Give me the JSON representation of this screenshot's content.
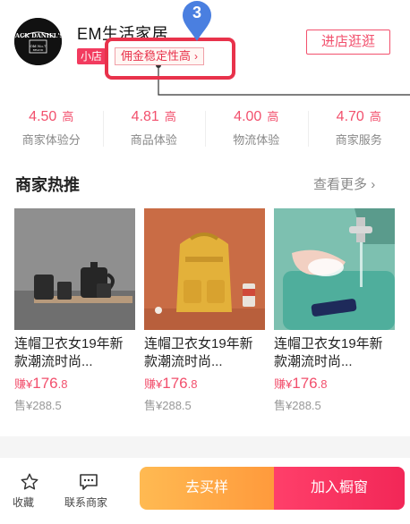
{
  "shop": {
    "name": "EM生活家居",
    "tag": "小店",
    "commission_label": "佣金稳定性高",
    "enter_label": "进店逛逛",
    "logo_text": "JACK DANIEL'S"
  },
  "annotation": {
    "step_number": "3"
  },
  "ratings": [
    {
      "value": "4.50",
      "level": "高",
      "label": "商家体验分"
    },
    {
      "value": "4.81",
      "level": "高",
      "label": "商品体验"
    },
    {
      "value": "4.00",
      "level": "高",
      "label": "物流体验"
    },
    {
      "value": "4.70",
      "level": "高",
      "label": "商家服务"
    }
  ],
  "recommend": {
    "title": "商家热推",
    "more_label": "查看更多",
    "products": [
      {
        "title": "连帽卫衣女19年新款潮流时尚...",
        "earn_prefix": "赚¥",
        "earn_int": "176",
        "earn_dec": ".8",
        "sale": "售¥288.5",
        "image": "coffee-set"
      },
      {
        "title": "连帽卫衣女19年新款潮流时尚...",
        "earn_prefix": "赚¥",
        "earn_int": "176",
        "earn_dec": ".8",
        "sale": "售¥288.5",
        "image": "yellow-backpack"
      },
      {
        "title": "连帽卫衣女19年新款潮流时尚...",
        "earn_prefix": "赚¥",
        "earn_int": "176",
        "earn_dec": ".8",
        "sale": "售¥288.5",
        "image": "hand-washing-sink"
      }
    ]
  },
  "bottom": {
    "favorite_label": "收藏",
    "contact_label": "联系商家",
    "buy_sample_label": "去买样",
    "add_window_label": "加入橱窗"
  },
  "colors": {
    "accent": "#f2506d",
    "highlight": "#e8324b",
    "pin": "#4a7fe0",
    "buy_start": "#ffba52",
    "add_end": "#f22757"
  }
}
